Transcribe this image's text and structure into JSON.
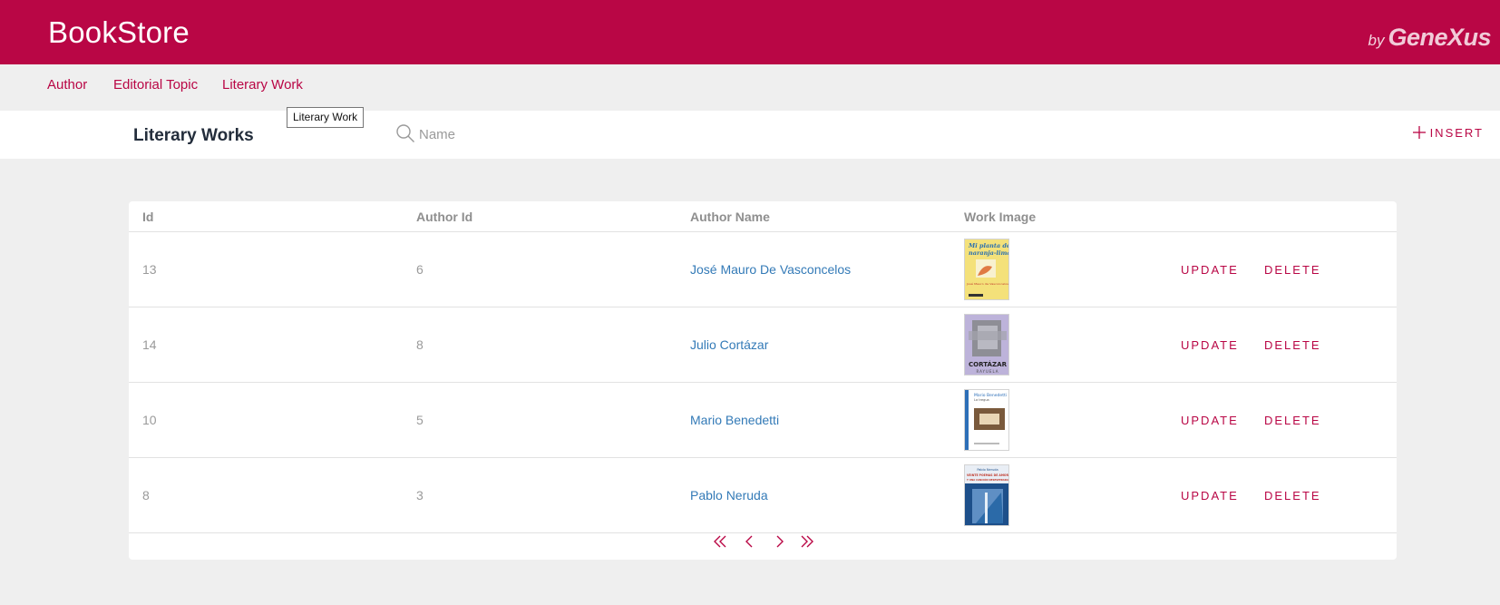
{
  "app": {
    "title": "BookStore",
    "by": "by",
    "brand": "GeneXus"
  },
  "menu": {
    "items": [
      "Author",
      "Editorial Topic",
      "Literary Work"
    ]
  },
  "tooltip": "Literary Work",
  "page": {
    "title": "Literary Works"
  },
  "search": {
    "placeholder": "Name",
    "value": ""
  },
  "insert_label": "INSERT",
  "grid": {
    "columns": [
      "Id",
      "Author Id",
      "Author Name",
      "Work Image"
    ],
    "rows": [
      {
        "id": "13",
        "author_id": "6",
        "author_name": "José Mauro De Vasconcelos"
      },
      {
        "id": "14",
        "author_id": "8",
        "author_name": "Julio Cortázar"
      },
      {
        "id": "10",
        "author_id": "5",
        "author_name": "Mario Benedetti"
      },
      {
        "id": "8",
        "author_id": "3",
        "author_name": "Pablo Neruda"
      }
    ],
    "update_label": "UPDATE",
    "delete_label": "DELETE"
  },
  "covers": [
    {
      "line1": "Mi planta de",
      "line2": "naranja-lima",
      "author": "José Mauro de Vasconcelos"
    },
    {
      "line1": "CORTÁZAR",
      "line2": "RAYUELA"
    },
    {
      "author": "Mario Benedetti",
      "line1": "La tregua"
    },
    {
      "author": "Pablo Neruda",
      "line1": "VEINTE POEMAS DE AMOR",
      "line2": "Y UNA CANCIÓN DESESPERADA"
    }
  ],
  "pager": {
    "first": "«",
    "prev": "‹",
    "next": "›",
    "last": "»"
  },
  "colors": {
    "brand": "#b90645",
    "link": "#337ab7",
    "background": "#efefef"
  }
}
